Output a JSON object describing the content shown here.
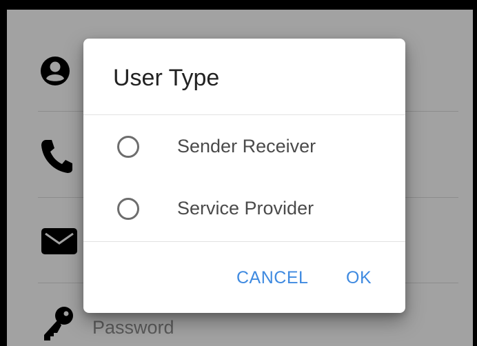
{
  "background_form": {
    "icons": [
      "user-icon",
      "phone-icon",
      "mail-icon",
      "key-icon"
    ],
    "password_placeholder": "Password"
  },
  "dialog": {
    "title": "User Type",
    "options": [
      {
        "label": "Sender Receiver",
        "selected": false
      },
      {
        "label": "Service Provider",
        "selected": false
      }
    ],
    "cancel_label": "CANCEL",
    "ok_label": "OK",
    "accent_color": "#3f8ae0"
  }
}
